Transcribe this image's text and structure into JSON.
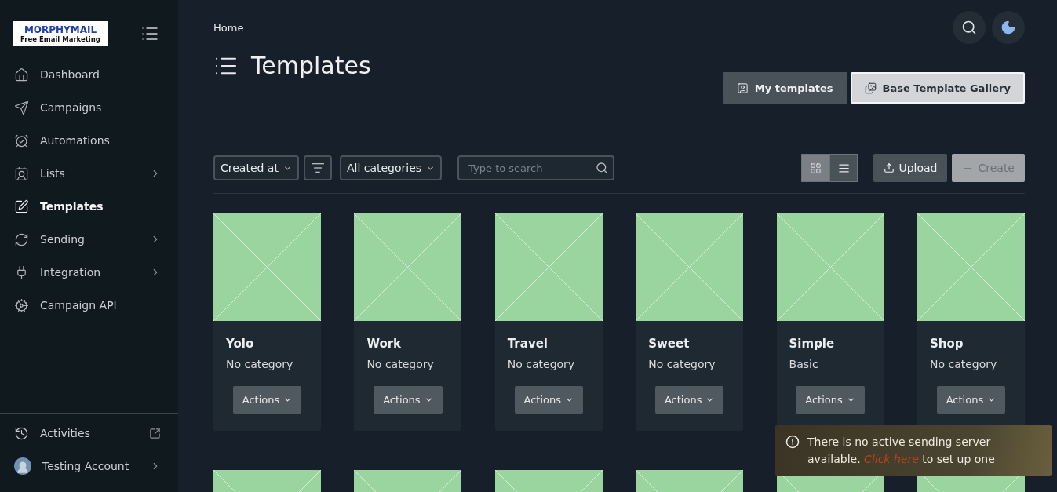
{
  "logo": {
    "name": "MORPHYMAIL",
    "tagline": "Free Email Marketing"
  },
  "sidebar": {
    "items": [
      {
        "label": "Dashboard",
        "selected": false,
        "has_submenu": false
      },
      {
        "label": "Campaigns",
        "selected": false,
        "has_submenu": false
      },
      {
        "label": "Automations",
        "selected": false,
        "has_submenu": false
      },
      {
        "label": "Lists",
        "selected": false,
        "has_submenu": true
      },
      {
        "label": "Templates",
        "selected": true,
        "has_submenu": false
      },
      {
        "label": "Sending",
        "selected": false,
        "has_submenu": true
      },
      {
        "label": "Integration",
        "selected": false,
        "has_submenu": true
      },
      {
        "label": "Campaign API",
        "selected": false,
        "has_submenu": false
      }
    ],
    "footer": [
      {
        "kind": "activities",
        "label": "Activities"
      },
      {
        "kind": "account",
        "label": "Testing Account"
      }
    ]
  },
  "breadcrumb": "Home",
  "title": "Templates",
  "tabs": [
    {
      "label": "My templates",
      "selected": false
    },
    {
      "label": "Base Template Gallery",
      "selected": true
    }
  ],
  "toolbar": {
    "sort": "Created at",
    "category": "All categories",
    "search": {
      "placeholder": "Type to search"
    },
    "views": [
      {
        "kind": "grid",
        "selected": true
      },
      {
        "kind": "list",
        "selected": false
      }
    ],
    "upload": "Upload",
    "create": {
      "label": "Create",
      "disabled": true
    }
  },
  "cards": [
    {
      "kind": "full",
      "name": "Yolo",
      "category": "No category",
      "action": "Actions"
    },
    {
      "kind": "full",
      "name": "Work",
      "category": "No category",
      "action": "Actions"
    },
    {
      "kind": "full",
      "name": "Travel",
      "category": "No category",
      "action": "Actions"
    },
    {
      "kind": "full",
      "name": "Sweet",
      "category": "No category",
      "action": "Actions"
    },
    {
      "kind": "full",
      "name": "Simple",
      "category": "Basic",
      "action": "Actions"
    },
    {
      "kind": "full",
      "name": "Shop",
      "category": "No category",
      "action": "Actions"
    },
    {
      "kind": "cut"
    },
    {
      "kind": "cut"
    },
    {
      "kind": "cut"
    },
    {
      "kind": "cut"
    },
    {
      "kind": "cut"
    },
    {
      "kind": "cut"
    }
  ],
  "toast": {
    "text": "There is no active sending server available.",
    "link": "Click here",
    "after": "to set up one"
  }
}
